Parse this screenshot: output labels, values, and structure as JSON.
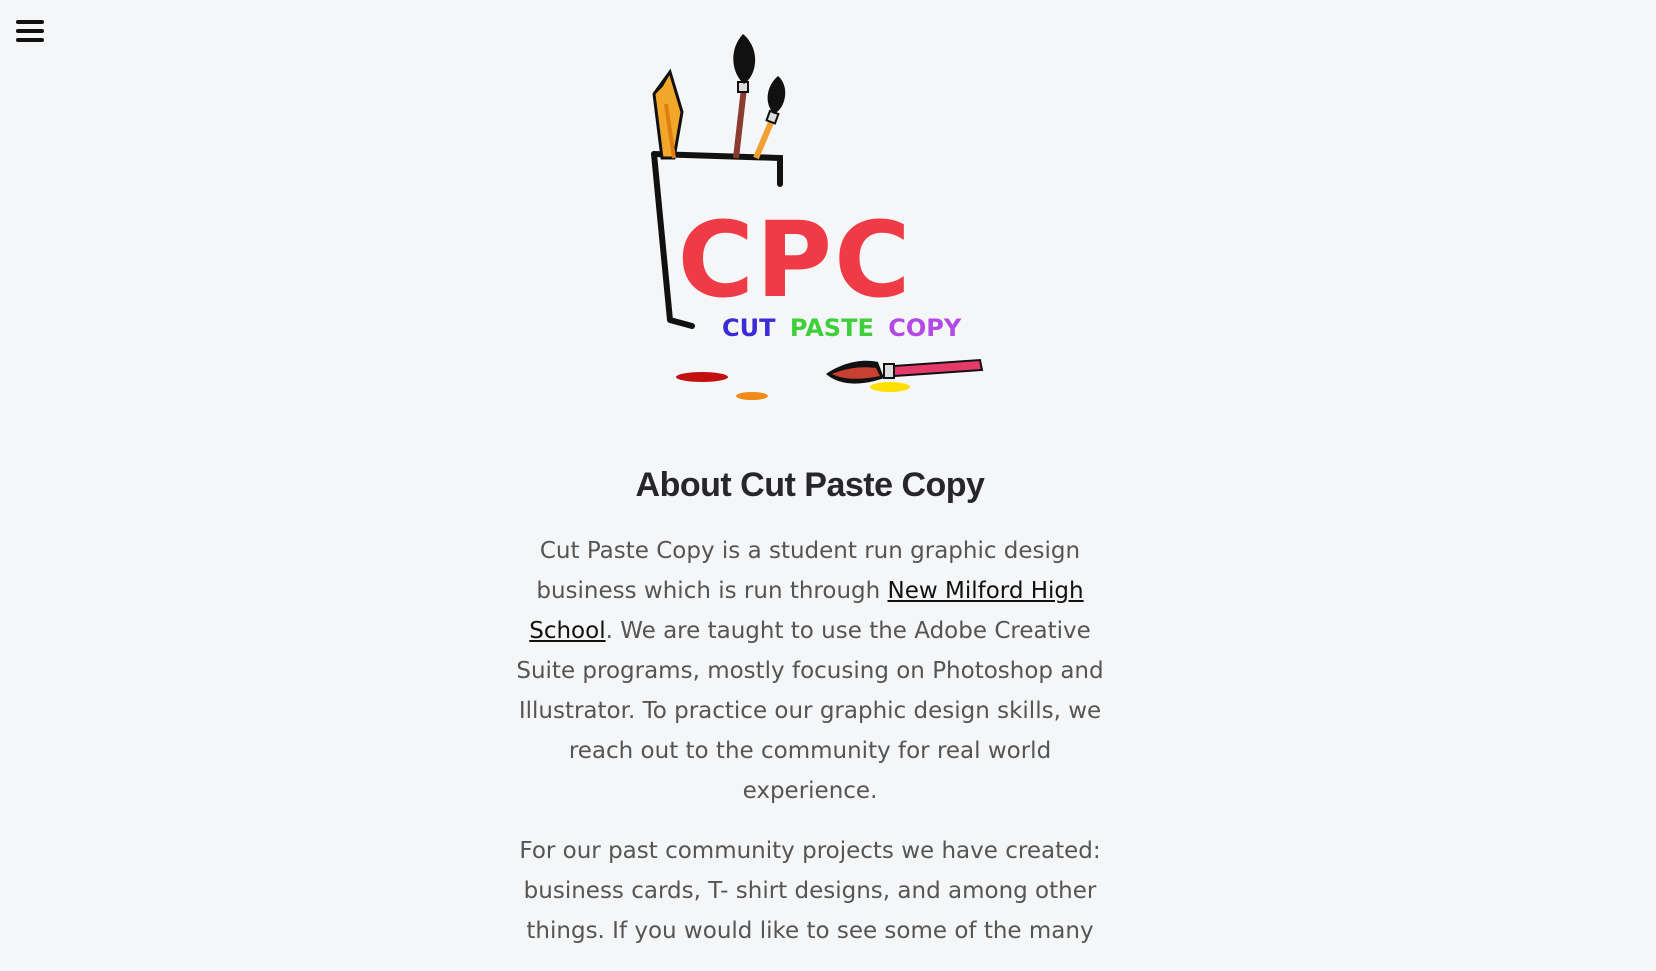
{
  "menu": {
    "icon": "hamburger-icon"
  },
  "logo": {
    "monogram": "CPC",
    "tagline_words": [
      "CUT",
      "PASTE",
      "COPY"
    ],
    "colors": {
      "monogram": "#ef3b45",
      "cut": "#3b2bd6",
      "paste": "#3ecf3b",
      "copy": "#b34ae6"
    }
  },
  "about": {
    "title": "About Cut Paste Copy",
    "p1_before": "Cut Paste Copy is a student run graphic design business which is run through ",
    "p1_link": "New Milford High School",
    "p1_after": ". We are taught to use the Adobe Creative Suite programs, mostly focusing on Photoshop and Illustrator. To practice our graphic design skills, we reach out to the community for real world experience.",
    "p2": "For our past community projects we have created: business cards, T- shirt designs, and among other things. If you would like to see some of the many"
  }
}
